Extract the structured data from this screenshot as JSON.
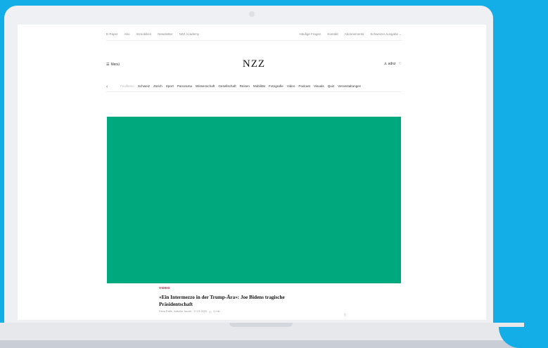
{
  "util_bar": {
    "left": [
      "E-Paper",
      "Abo",
      "Immobilien",
      "Newsletter",
      "NZZ Academy"
    ],
    "right": [
      "Häufige Fragen",
      "Kontakt",
      "Abonnements",
      "Schweizer Ausgabe"
    ],
    "edition_chevron": "⌄"
  },
  "header": {
    "menu_icon": "☰",
    "menu_label": "Menü",
    "logo": "NZZ",
    "user_icon": "♙",
    "user_label": "adnz",
    "idea_icon": "♡"
  },
  "nav": {
    "back_arrow": "‹",
    "items": [
      {
        "label": "Feuilleton",
        "faded": true
      },
      {
        "label": "Schweiz"
      },
      {
        "label": "Zürich"
      },
      {
        "label": "Sport"
      },
      {
        "label": "Panorama"
      },
      {
        "label": "Wissenschaft"
      },
      {
        "label": "Gesellschaft"
      },
      {
        "label": "Reisen"
      },
      {
        "label": "Mobilität"
      },
      {
        "label": "Fotografie"
      },
      {
        "label": "Video",
        "active": true
      },
      {
        "label": "Podcast"
      },
      {
        "label": "Visuals"
      },
      {
        "label": "Quiz"
      },
      {
        "label": "Veranstaltungen"
      }
    ]
  },
  "hero": {
    "color": "#00a87e"
  },
  "article": {
    "kicker": "VIDEO",
    "headline_line1": "«Ein Intermezzo in der Trump-Ära»: Joe Bidens tragische",
    "headline_line2": "Präsidentschaft",
    "authors": "Reza Rafie, Isabelle Jacobi",
    "date": "17.01.2025",
    "read_time": "5 min",
    "bookmark_icon": "▯"
  }
}
